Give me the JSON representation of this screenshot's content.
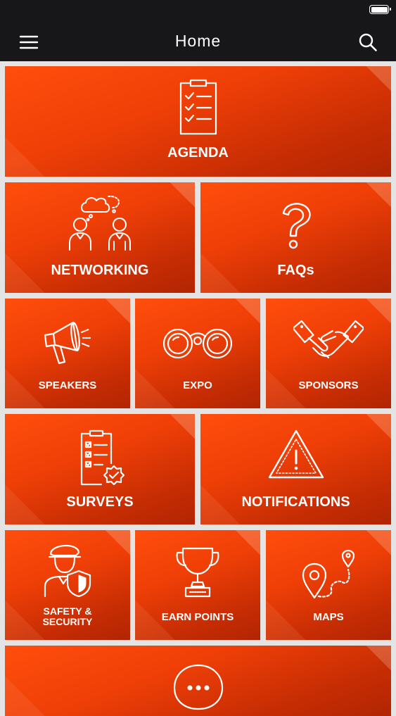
{
  "header": {
    "title": "Home"
  },
  "icons": {
    "menu": "hamburger-menu-icon",
    "search": "search-icon"
  },
  "colors": {
    "header_bg": "#17171a",
    "tile_orange": "#ef3f07",
    "tile_dark": "#b12503",
    "page_bg": "#e4e4e4"
  },
  "tiles": [
    {
      "label": "AGENDA",
      "icon": "checklist-icon"
    },
    {
      "label": "NETWORKING",
      "icon": "people-chat-icon"
    },
    {
      "label": "FAQs",
      "icon": "question-mark-icon"
    },
    {
      "label": "SPEAKERS",
      "icon": "megaphone-icon"
    },
    {
      "label": "EXPO",
      "icon": "binoculars-icon"
    },
    {
      "label": "SPONSORS",
      "icon": "handshake-icon"
    },
    {
      "label": "SURVEYS",
      "icon": "survey-checklist-icon"
    },
    {
      "label": "NOTIFICATIONS",
      "icon": "warning-triangle-icon"
    },
    {
      "label": "SAFETY & SECURITY",
      "icon": "security-guard-icon"
    },
    {
      "label": "EARN POINTS",
      "icon": "trophy-icon"
    },
    {
      "label": "MAPS",
      "icon": "map-route-icon"
    },
    {
      "label": "",
      "icon": "chat-bubble-icon"
    }
  ]
}
